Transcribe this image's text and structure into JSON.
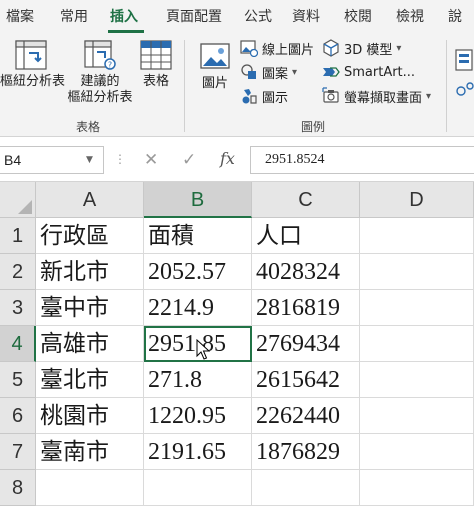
{
  "ribbon_tabs": [
    {
      "label": "檔案"
    },
    {
      "label": "常用"
    },
    {
      "label": "插入",
      "active": true
    },
    {
      "label": "頁面配置"
    },
    {
      "label": "公式"
    },
    {
      "label": "資料"
    },
    {
      "label": "校閱"
    },
    {
      "label": "檢視"
    },
    {
      "label": "說"
    }
  ],
  "ribbon": {
    "tables_group": {
      "label": "表格",
      "pivot_table": {
        "line1": "樞紐分析表",
        "icon": "pivot-table-icon"
      },
      "recommended_pivot": {
        "line1": "建議的",
        "line2": "樞紐分析表",
        "icon": "recommended-pivot-icon"
      },
      "table": {
        "line1": "表格",
        "icon": "table-icon"
      }
    },
    "illustrations_group": {
      "label": "圖例",
      "pictures": {
        "label": "圖片",
        "icon": "picture-icon"
      },
      "online_pictures": {
        "label": "線上圖片",
        "icon": "online-picture-icon"
      },
      "shapes": {
        "label": "圖案",
        "icon": "shapes-icon"
      },
      "icons": {
        "label": "圖示",
        "icon": "icons-icon"
      },
      "models_3d": {
        "label": "3D 模型",
        "icon": "3d-model-icon"
      },
      "smartart": {
        "label": "SmartArt...",
        "icon": "smartart-icon"
      },
      "screenshot": {
        "label": "螢幕擷取畫面",
        "icon": "screenshot-icon"
      }
    }
  },
  "formula_bar": {
    "name_box": "B4",
    "cancel_icon": "✕",
    "enter_icon": "✓",
    "fx_label": "fx",
    "formula": "2951.8524"
  },
  "sheet": {
    "columns": [
      "A",
      "B",
      "C",
      "D"
    ],
    "rows": [
      "1",
      "2",
      "3",
      "4",
      "5",
      "6",
      "7",
      "8"
    ],
    "selected_cell": "B4",
    "cells": [
      [
        "行政區",
        "面積",
        "人口"
      ],
      [
        "新北市",
        "2052.57",
        "4028324"
      ],
      [
        "臺中市",
        "2214.9",
        "2816819"
      ],
      [
        "高雄市",
        "2951.85",
        "2769434"
      ],
      [
        "臺北市",
        "271.8",
        "2615642"
      ],
      [
        "桃園市",
        "1220.95",
        "2262440"
      ],
      [
        "臺南市",
        "2191.65",
        "1876829"
      ],
      [
        "",
        "",
        ""
      ]
    ]
  },
  "colors": {
    "accent": "#1e7145",
    "selection": "#217346",
    "ribbon_bg": "#f3f3f3",
    "header_bg": "#e6e6e6"
  }
}
